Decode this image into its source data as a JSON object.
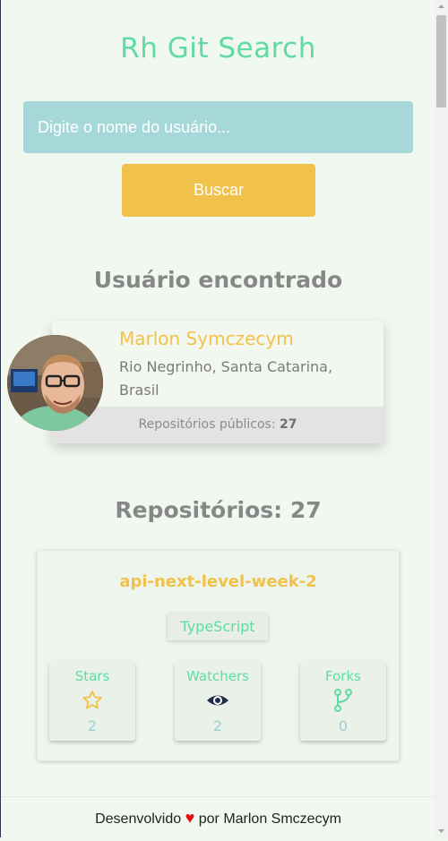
{
  "header": {
    "title": "Rh Git Search"
  },
  "search": {
    "placeholder": "Digite o nome do usuário...",
    "value": "",
    "button_label": "Buscar"
  },
  "user_section": {
    "heading": "Usuário encontrado",
    "name": "Marlon Symczecym",
    "location": "Rio Negrinho, Santa Catarina, Brasil",
    "public_repos_label": "Repositórios públicos:",
    "public_repos_count": "27"
  },
  "repos_section": {
    "heading": "Repositórios: 27",
    "repos": [
      {
        "name": "api-next-level-week-2",
        "language": "TypeScript",
        "stats": [
          {
            "label": "Stars",
            "icon": "star-icon",
            "value": "2"
          },
          {
            "label": "Watchers",
            "icon": "eye-icon",
            "value": "2"
          },
          {
            "label": "Forks",
            "icon": "fork-icon",
            "value": "0"
          }
        ]
      }
    ]
  },
  "footer": {
    "text_before": "Desenvolvido",
    "heart": "♥",
    "text_after": "por Marlon Smczecym"
  },
  "colors": {
    "accent_green": "#5fdba3",
    "accent_yellow": "#f1c24b",
    "input_bg": "#a6d8da",
    "background": "#f0f8f0",
    "heart": "#e01010"
  }
}
